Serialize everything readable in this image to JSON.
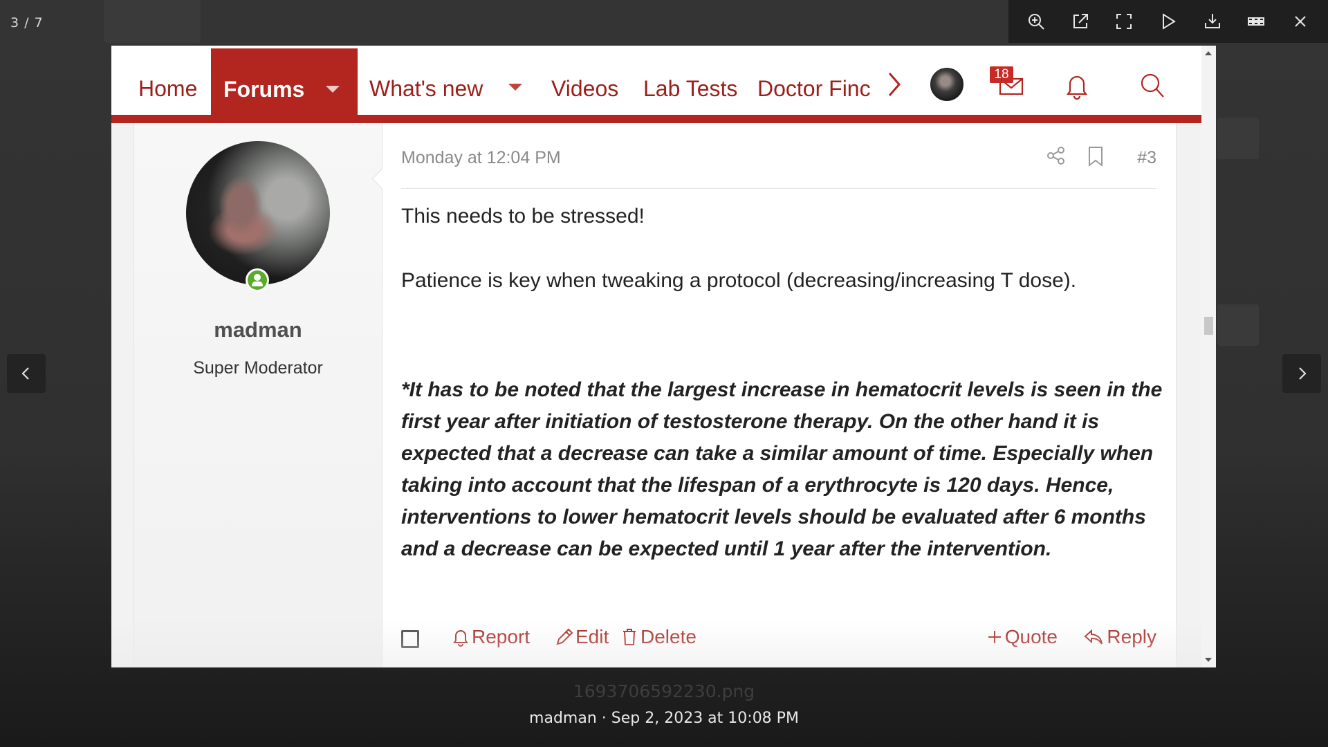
{
  "lightbox": {
    "counter": "3 / 7",
    "toolbar": [
      "zoom-in-icon",
      "open-new-window-icon",
      "fullscreen-icon",
      "play-slideshow-icon",
      "download-icon",
      "thumbnails-icon",
      "close-icon"
    ],
    "filename": "1693706592230.png",
    "caption": "madman · Sep 2, 2023 at 10:08 PM"
  },
  "nav": {
    "home": "Home",
    "forums": "Forums",
    "whats_new": "What's new",
    "videos": "Videos",
    "lab_tests": "Lab Tests",
    "doctor_finder": "Doctor Finc",
    "inbox_count": "18"
  },
  "post": {
    "author": "madman",
    "author_title": "Super Moderator",
    "date": "Monday at 12:04 PM",
    "number": "#3",
    "paragraph1": "This needs to be stressed!",
    "paragraph2": "Patience is key when tweaking a protocol (decreasing/increasing T dose).",
    "quote": "*It has to be noted that the largest increase in hematocrit levels is seen in the first year after initiation of testosterone therapy. On the other hand it is expected that a decrease can take a similar amount of time. Especially when taking into account that the lifespan of a erythrocyte is 120 days. Hence, interventions to lower hematocrit levels should be evaluated after 6 months and a decrease can be expected until 1 year after the intervention.",
    "actions": {
      "report": "Report",
      "edit": "Edit",
      "delete": "Delete",
      "quote": "Quote",
      "reply": "Reply"
    }
  },
  "colors": {
    "brand": "#b3251f",
    "link": "#a8231d",
    "online": "#5aab2a"
  }
}
